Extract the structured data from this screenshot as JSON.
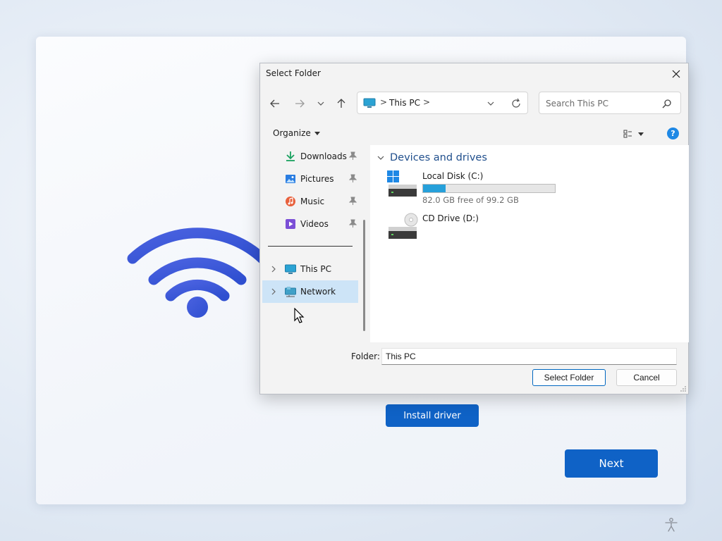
{
  "setup": {
    "install_button": "Install driver",
    "next_button": "Next",
    "accent_color": "#0f62c6"
  },
  "dialog": {
    "title": "Select Folder",
    "address": {
      "crumb": "This PC",
      "separator": ">"
    },
    "search": {
      "placeholder": "Search This PC"
    },
    "toolbar": {
      "organize_label": "Organize",
      "help_label": "?"
    },
    "nav": {
      "quick_access": [
        {
          "label": "Downloads",
          "icon": "downloads-icon",
          "pinned": true
        },
        {
          "label": "Pictures",
          "icon": "pictures-icon",
          "pinned": true
        },
        {
          "label": "Music",
          "icon": "music-icon",
          "pinned": true
        },
        {
          "label": "Videos",
          "icon": "videos-icon",
          "pinned": true
        }
      ],
      "tree": [
        {
          "label": "This PC",
          "icon": "this-pc-icon"
        },
        {
          "label": "Network",
          "icon": "network-icon",
          "selected": true
        }
      ]
    },
    "content": {
      "group_header": "Devices and drives",
      "drives": [
        {
          "name": "Local Disk (C:)",
          "free_text": "82.0 GB free of 99.2 GB",
          "used_fraction": 0.173,
          "icon": "local-disk-icon"
        },
        {
          "name": "CD Drive (D:)",
          "icon": "cd-drive-icon"
        }
      ]
    },
    "footer": {
      "folder_label": "Folder:",
      "folder_value": "This PC",
      "select_button": "Select Folder",
      "cancel_button": "Cancel"
    }
  }
}
